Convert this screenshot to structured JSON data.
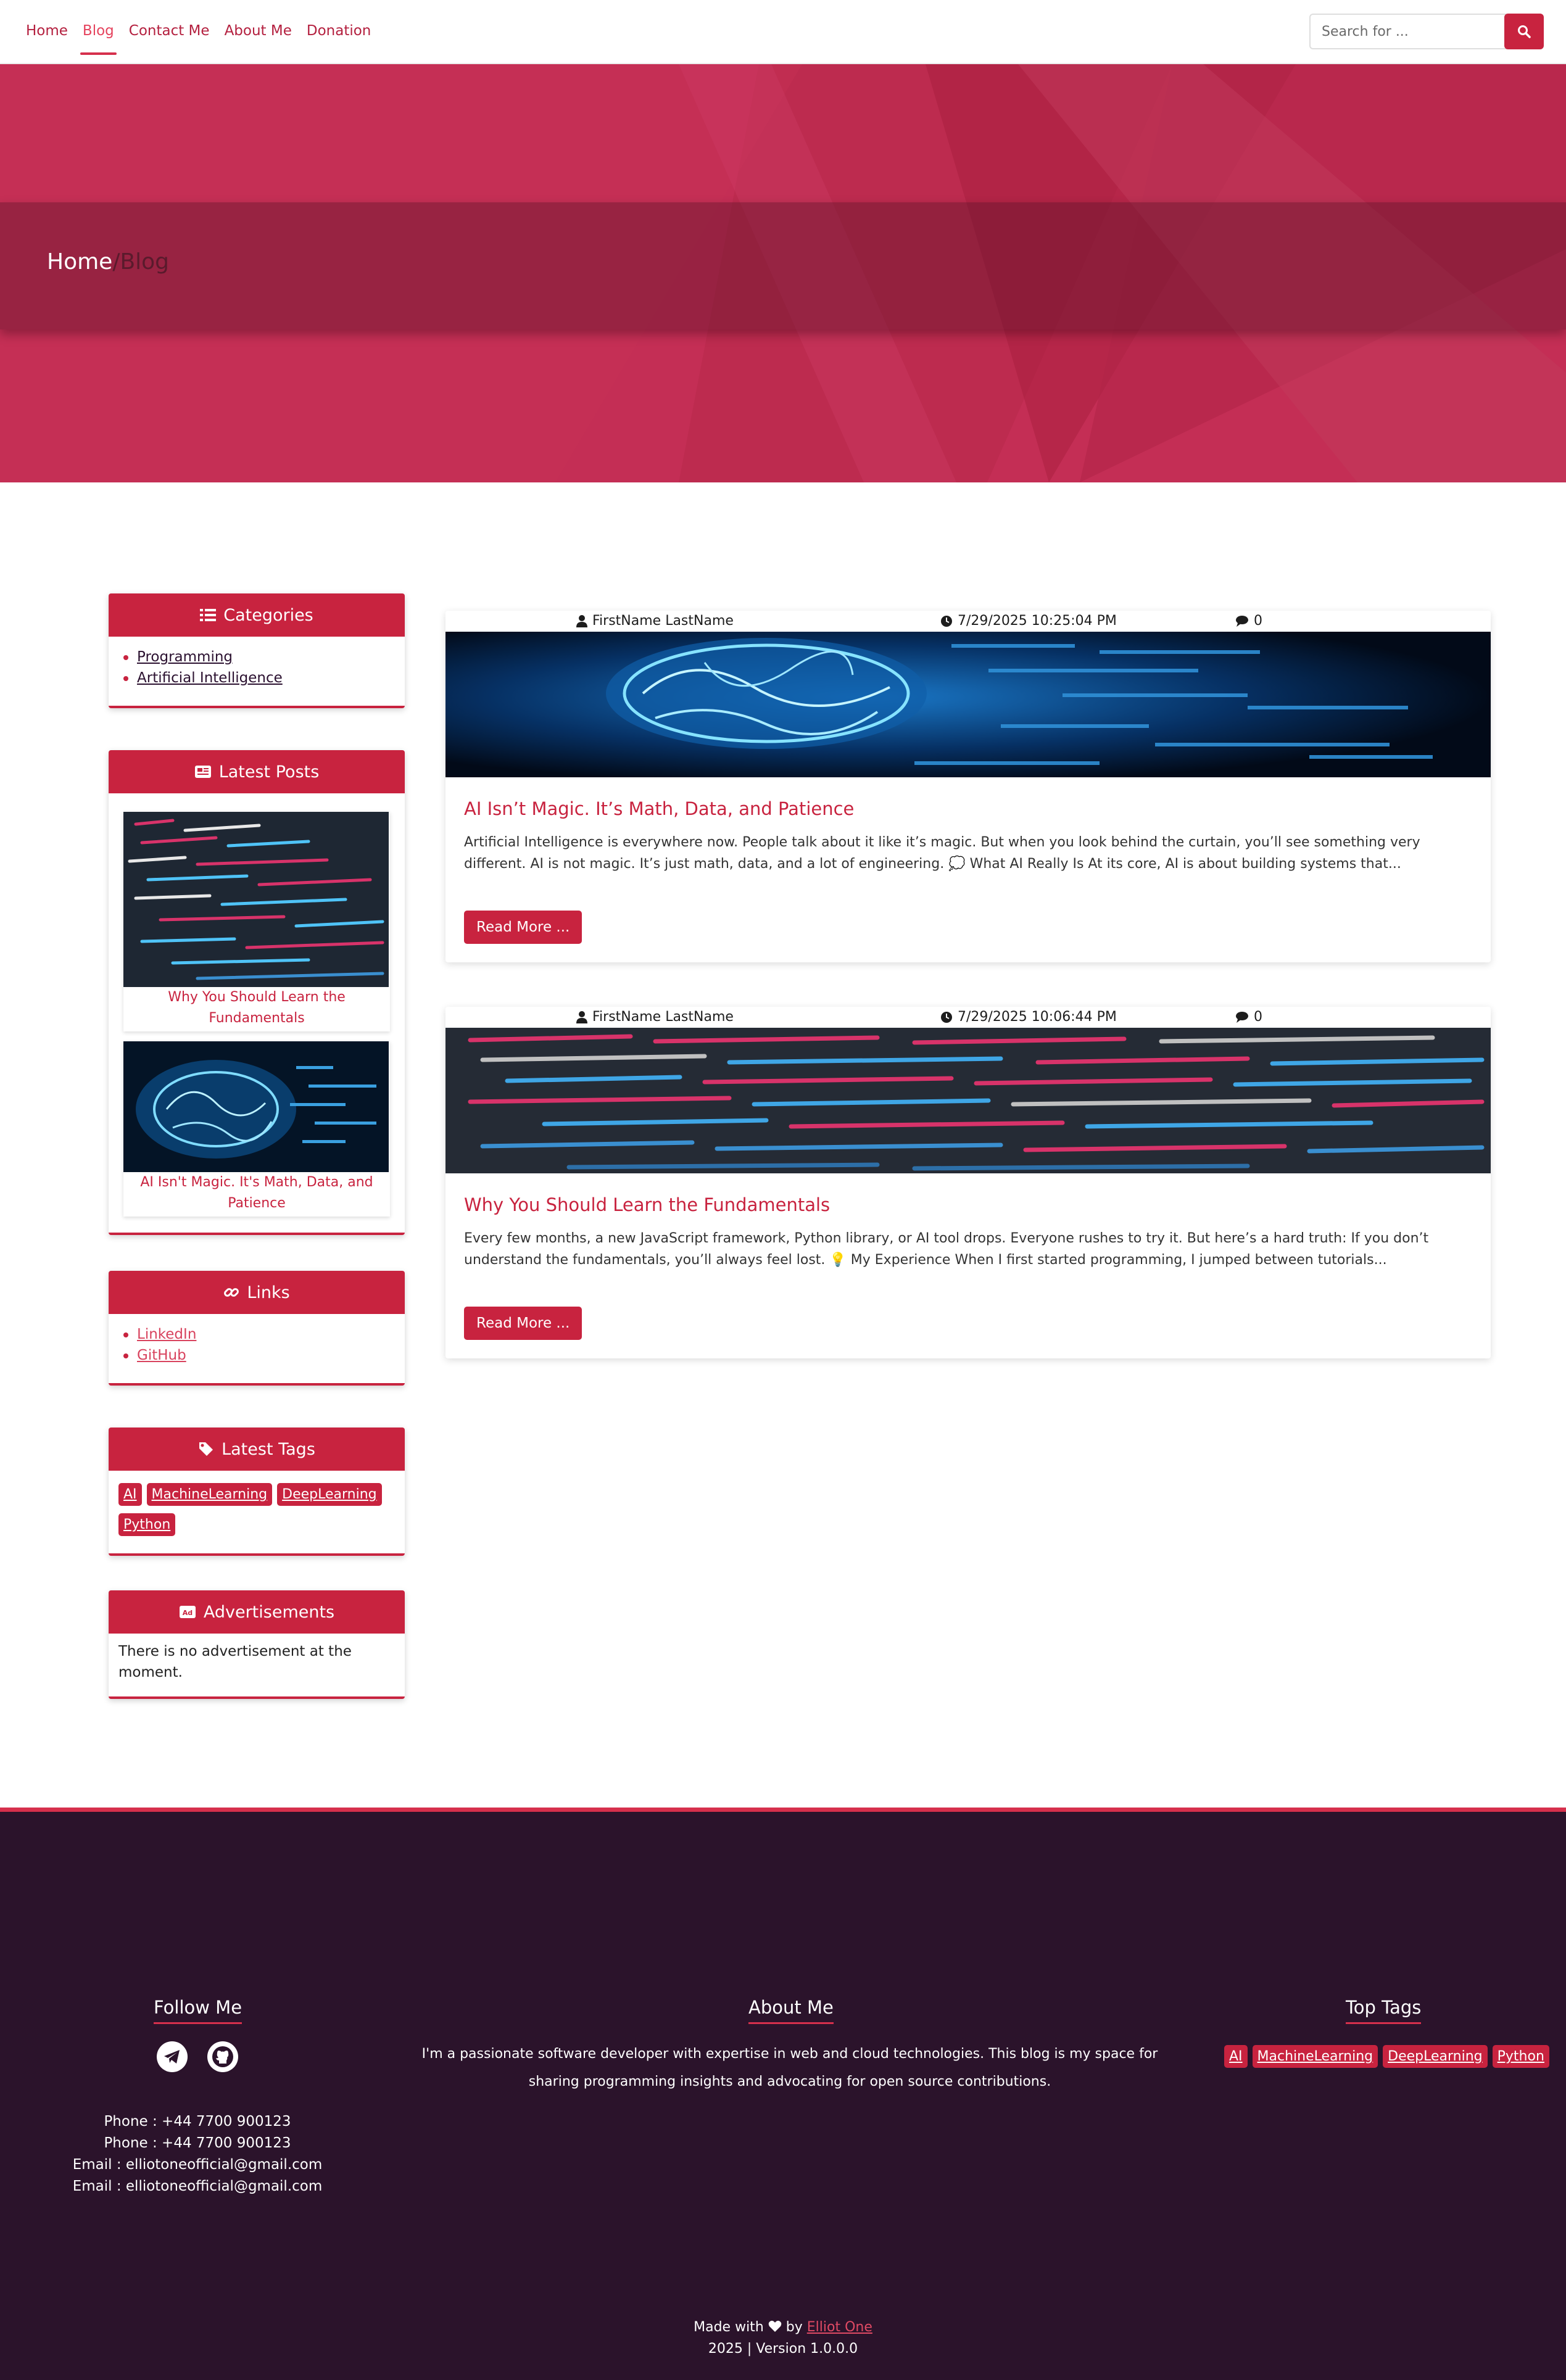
{
  "nav": {
    "links": [
      "Home",
      "Blog",
      "Contact Me",
      "About Me",
      "Donation"
    ],
    "active": "Blog",
    "search_placeholder": "Search for ..."
  },
  "hero": {
    "crumb_home": "Home",
    "crumb_sep": "/",
    "crumb_current": "Blog"
  },
  "sidebar": {
    "categories": {
      "title": "Categories",
      "items": [
        "Programming",
        "Artificial Intelligence"
      ]
    },
    "latest_posts": {
      "title": "Latest Posts",
      "items": [
        {
          "title": "Why You Should Learn the Fundamentals"
        },
        {
          "title": "AI Isn't Magic. It's Math, Data, and Patience"
        }
      ]
    },
    "links": {
      "title": "Links",
      "items": [
        "LinkedIn",
        "GitHub"
      ]
    },
    "latest_tags": {
      "title": "Latest Tags",
      "items": [
        "AI",
        "MachineLearning",
        "DeepLearning",
        "Python"
      ]
    },
    "ads": {
      "title": "Advertisements",
      "text": "There is no advertisement at the moment."
    }
  },
  "posts": [
    {
      "author": "FirstName LastName",
      "date": "7/29/2025 10:25:04 PM",
      "comments": "0",
      "title": "AI Isn’t Magic. It’s Math, Data, and Patience",
      "excerpt": "Artificial Intelligence is everywhere now. People talk about it like it’s magic. But when you look behind the curtain, you’ll see something very different. AI is not magic. It’s just math, data, and a lot of engineering. 💭 What AI Really Is At its core, AI is about building systems that...",
      "read_more": "Read More ..."
    },
    {
      "author": "FirstName LastName",
      "date": "7/29/2025 10:06:44 PM",
      "comments": "0",
      "title": "Why You Should Learn the Fundamentals",
      "excerpt": "Every few months, a new JavaScript framework, Python library, or AI tool drops. Everyone rushes to try it. But here’s a hard truth: If you don’t understand the fundamentals, you’ll always feel lost. 💡 My Experience When I first started programming, I jumped between tutorials...",
      "read_more": "Read More ..."
    }
  ],
  "footer": {
    "follow_title": "Follow Me",
    "social_icons": [
      "telegram-icon",
      "github-icon"
    ],
    "contacts": [
      "Phone : +44 7700 900123",
      "Phone : +44 7700 900123",
      "Email : elliotoneofficial@gmail.com",
      "Email : elliotoneofficial@gmail.com"
    ],
    "about_title": "About Me",
    "about_text": "I'm a passionate software developer with expertise in web and cloud technologies. This blog is my space for sharing programming insights and advocating for open source contributions.",
    "tags_title": "Top Tags",
    "tags": [
      "AI",
      "MachineLearning",
      "DeepLearning",
      "Python"
    ],
    "made_with": "Made with",
    "by": "by",
    "author_link": "Elliot One",
    "version": "2025 | Version 1.0.0.0"
  },
  "colors": {
    "accent": "#c8233f",
    "footer_bg": "#2b132b",
    "hero_bg": "#c42e55"
  }
}
